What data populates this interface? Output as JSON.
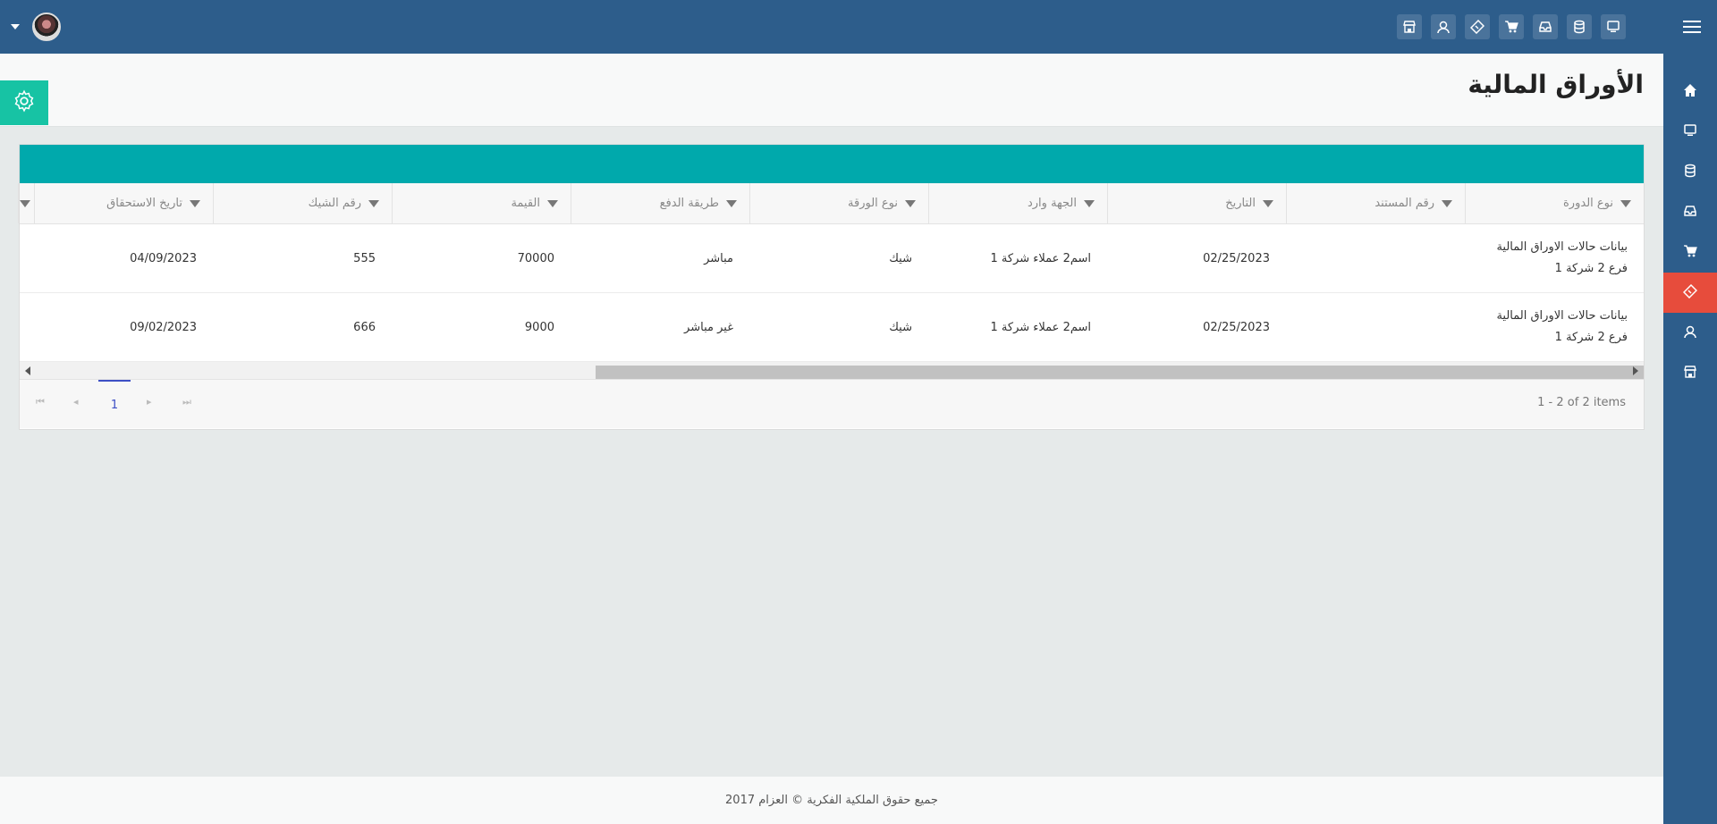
{
  "page": {
    "title": "الأوراق المالية"
  },
  "topbar": {
    "icons": [
      "monitor-icon",
      "database-icon",
      "inbox-icon",
      "cart-icon",
      "ticket-icon",
      "user-icon",
      "store-icon"
    ]
  },
  "sidebar": {
    "items": [
      "home-icon",
      "monitor-icon",
      "database-icon",
      "inbox-icon",
      "cart-icon",
      "ticket-icon",
      "user-icon",
      "store-icon"
    ],
    "active_index": 5
  },
  "grid": {
    "columns": [
      "نوع الدورة",
      "رقم المستند",
      "التاريخ",
      "الجهة وارد",
      "نوع الورقة",
      "طريقة الدفع",
      "القيمة",
      "رقم الشيك",
      "تاريخ الاستحقاق"
    ],
    "rows": [
      {
        "cycle_line1": "بيانات حالات الاوراق المالية",
        "cycle_line2": "فرع 2 شركة 1",
        "doc_no": "",
        "date": "02/25/2023",
        "party": "اسم2 عملاء شركة 1",
        "paper_type": "شيك",
        "payment_method": "مباشر",
        "value": "70000",
        "cheque_no": "555",
        "due_date": "04/09/2023"
      },
      {
        "cycle_line1": "بيانات حالات الاوراق المالية",
        "cycle_line2": "فرع 2 شركة 1",
        "doc_no": "",
        "date": "02/25/2023",
        "party": "اسم2 عملاء شركة 1",
        "paper_type": "شيك",
        "payment_method": "غير مباشر",
        "value": "9000",
        "cheque_no": "666",
        "due_date": "09/02/2023"
      }
    ]
  },
  "pager": {
    "current_page": "1",
    "info": "1 - 2 of 2 items"
  },
  "footer": {
    "text": "جميع حقوق الملكية الفكرية © العزام 2017"
  },
  "colors": {
    "brand": "#2d5d8b",
    "teal": "#00a9ac",
    "active": "#e74c3c",
    "gear": "#17c3a4"
  }
}
